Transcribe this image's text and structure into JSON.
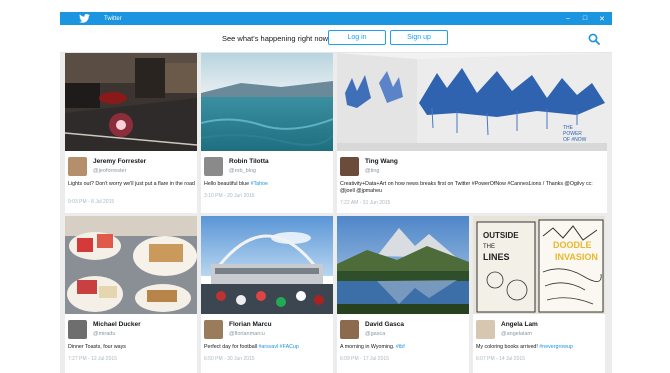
{
  "window": {
    "title": "Twitter"
  },
  "header": {
    "tagline": "See what's happening right now.",
    "login_label": "Log in",
    "signup_label": "Sign up"
  },
  "tweets": [
    {
      "name": "Jeremy Forrester",
      "handle": "@jeoforrester",
      "text": "Lights out? Don't worry we'll just put a flare in the road",
      "links": "",
      "time": "9:03 PM - 8 Jul 2015"
    },
    {
      "name": "Robin Tilotta",
      "handle": "@rob_blog",
      "text": "Hello beautiful blue ",
      "links": "#Tahoe",
      "time": "3:10 PM - 20 Jun 2015"
    },
    {
      "name": "Ting Wang",
      "handle": "@ting",
      "text": "Creativity+Data+Art on how news breaks first on Twitter #PowerOfNow #CannesLions / Thanks @Ogilvy cc: @joell @jpmaheu",
      "links": "",
      "time": "7:22 AM - 31 Jun 2015"
    },
    {
      "name": "Michael Ducker",
      "handle": "@miradu",
      "text": "Dinner Toasts, four ways",
      "links": "",
      "time": "7:27 PM - 12 Jul 2015"
    },
    {
      "name": "Florian Marcu",
      "handle": "@florianmarcu",
      "text": "Perfect day for football ",
      "links": "#arsvavl #FACup",
      "time": "6:50 PM - 30 Jun 2015"
    },
    {
      "name": "David Gasca",
      "handle": "@gasca",
      "text": "A morning in Wyoming. ",
      "links": "#tbf",
      "time": "6:09 PM - 17 Jul 2015"
    },
    {
      "name": "Angela Lam",
      "handle": "@angelalam",
      "text": "My coloring books arrived! ",
      "links": "#nevergrowup",
      "time": "6:07 PM - 14 Jul 2015"
    }
  ],
  "colors": {
    "brand": "#1b95e0",
    "link": "#1b95e0",
    "bg": "#ececec"
  },
  "icons": {
    "logo": "bird-icon",
    "search": "search-icon"
  }
}
